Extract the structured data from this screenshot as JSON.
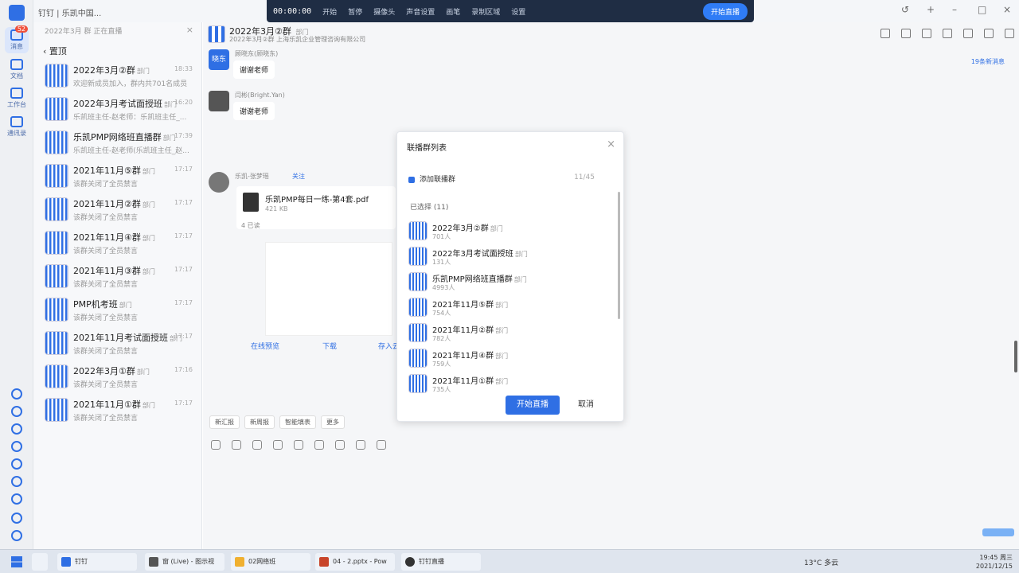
{
  "window": {
    "title": "钉钉 | 乐凯中国...",
    "rail": [
      {
        "label": "消息",
        "badge": "52",
        "icon": "message-icon"
      },
      {
        "label": "文档",
        "icon": "doc-icon"
      },
      {
        "label": "工作台",
        "icon": "workbench-icon"
      },
      {
        "label": "通讯录",
        "icon": "contacts-icon"
      }
    ]
  },
  "recorder": {
    "time": "00:00:00",
    "buttons": [
      "开始",
      "暂停",
      "摄像头",
      "声音设置",
      "画笔",
      "录制区域",
      "设置"
    ],
    "stop_label": "开始直播"
  },
  "chatlist": {
    "header": "2022年3月 群 正在直播",
    "back_label": "置顶",
    "items": [
      {
        "name": "2022年3月②群",
        "tag": "部门",
        "time": "18:33",
        "preview": "欢迎新成员加入，群内共701名成员"
      },
      {
        "name": "2022年3月考试面授班",
        "tag": "部门",
        "time": "16:20",
        "preview": "乐凯班主任-赵老师：乐凯班主任_..."
      },
      {
        "name": "乐凯PMP网络班直播群",
        "tag": "部门",
        "time": "17:39",
        "preview": "乐凯班主任-赵老师(乐凯班主任_赵..."
      },
      {
        "name": "2021年11月⑤群",
        "tag": "部门",
        "time": "17:17",
        "preview": "该群关闭了全员禁言"
      },
      {
        "name": "2021年11月②群",
        "tag": "部门",
        "time": "17:17",
        "preview": "该群关闭了全员禁言"
      },
      {
        "name": "2021年11月④群",
        "tag": "部门",
        "time": "17:17",
        "preview": "该群关闭了全员禁言"
      },
      {
        "name": "2021年11月③群",
        "tag": "部门",
        "time": "17:17",
        "preview": "该群关闭了全员禁言"
      },
      {
        "name": "PMP机考班",
        "tag": "部门",
        "time": "17:17",
        "preview": "该群关闭了全员禁言"
      },
      {
        "name": "2021年11月考试面授班",
        "tag": "部门",
        "time": "17:17",
        "preview": "该群关闭了全员禁言"
      },
      {
        "name": "2022年3月①群",
        "tag": "部门",
        "time": "17:16",
        "preview": "该群关闭了全员禁言"
      },
      {
        "name": "2021年11月①群",
        "tag": "部门",
        "time": "17:17",
        "preview": "该群关闭了全员禁言"
      }
    ]
  },
  "conversation": {
    "title": "2022年3月②群",
    "title_tag": "部门",
    "subtitle": "2022年3月②群 上海乐凯企业管理咨询有限公司",
    "unread": "19条新消息",
    "messages": [
      {
        "sender": "顾晓东(顾晓东)",
        "text": "谢谢老师",
        "avatar_text": "晓东"
      },
      {
        "sender": "闫彬(Bright.Yan)",
        "text": "谢谢老师"
      },
      {
        "sender": "乐凯-张梦瑶",
        "text": "关注"
      }
    ],
    "file": {
      "name": "乐凯PMP每日一练-第4套.pdf",
      "size": "421 KB",
      "read": "4 已读"
    },
    "file_actions": [
      "在线预览",
      "下载",
      "存入云盘"
    ],
    "quick_chips": [
      "新汇报",
      "新周报",
      "智能填表",
      "更多"
    ]
  },
  "modal": {
    "title": "联播群列表",
    "add_label": "添加联播群",
    "count": "11/45",
    "selected_label": "已选择 (11)",
    "groups": [
      {
        "name": "2022年3月②群",
        "tag": "部门",
        "members": "701人"
      },
      {
        "name": "2022年3月考试面授班",
        "tag": "部门",
        "members": "131人"
      },
      {
        "name": "乐凯PMP网络班直播群",
        "tag": "部门",
        "members": "4993人"
      },
      {
        "name": "2021年11月⑤群",
        "tag": "部门",
        "members": "754人"
      },
      {
        "name": "2021年11月②群",
        "tag": "部门",
        "members": "782人"
      },
      {
        "name": "2021年11月④群",
        "tag": "部门",
        "members": "759人"
      },
      {
        "name": "2021年11月①群",
        "tag": "部门",
        "members": "735人"
      }
    ],
    "start_label": "开始直播",
    "cancel_label": "取消"
  },
  "taskbar": {
    "apps": [
      {
        "label": "钉钉"
      },
      {
        "label": "窗 (Live) - 图示视"
      },
      {
        "label": "02网络班"
      },
      {
        "label": "04 - 2.pptx - Pow"
      },
      {
        "label": "钉钉直播"
      }
    ],
    "weather": "13°C 多云",
    "time": "19:45 周三",
    "date": "2021/12/15"
  },
  "colors": {
    "accent": "#2f6fe4",
    "recorder_bg": "#1f2d44"
  }
}
